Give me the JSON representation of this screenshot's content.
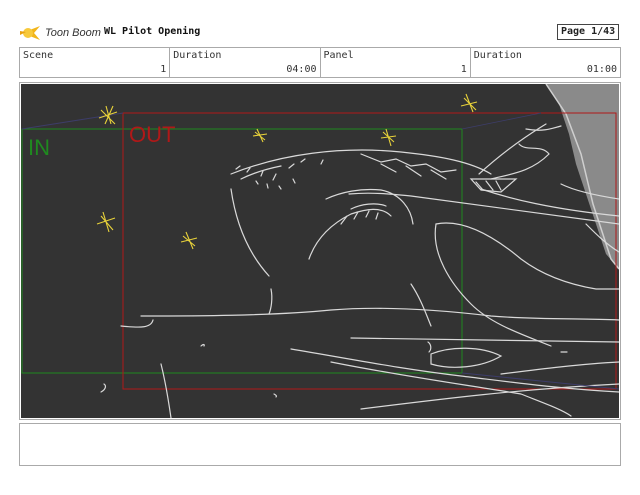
{
  "header": {
    "logo_text": "Toon Boom",
    "project_title": "WL Pilot Opening",
    "page": "Page  1/43"
  },
  "info": {
    "scene_label": "Scene",
    "scene_value": "1",
    "duration_label": "Duration",
    "duration_value": "04:00",
    "panel_label": "Panel",
    "panel_value": "1",
    "panel_duration_label": "Duration",
    "panel_duration_value": "01:00"
  },
  "frames": {
    "in_label": "IN",
    "out_label": "OUT",
    "in_color": "#1f8a1f",
    "out_color": "#b01818"
  },
  "colors": {
    "panel_bg": "#333333",
    "sketch": "#d9d9d9",
    "stars": "#e8d23a"
  },
  "notes": {
    "text": ""
  }
}
